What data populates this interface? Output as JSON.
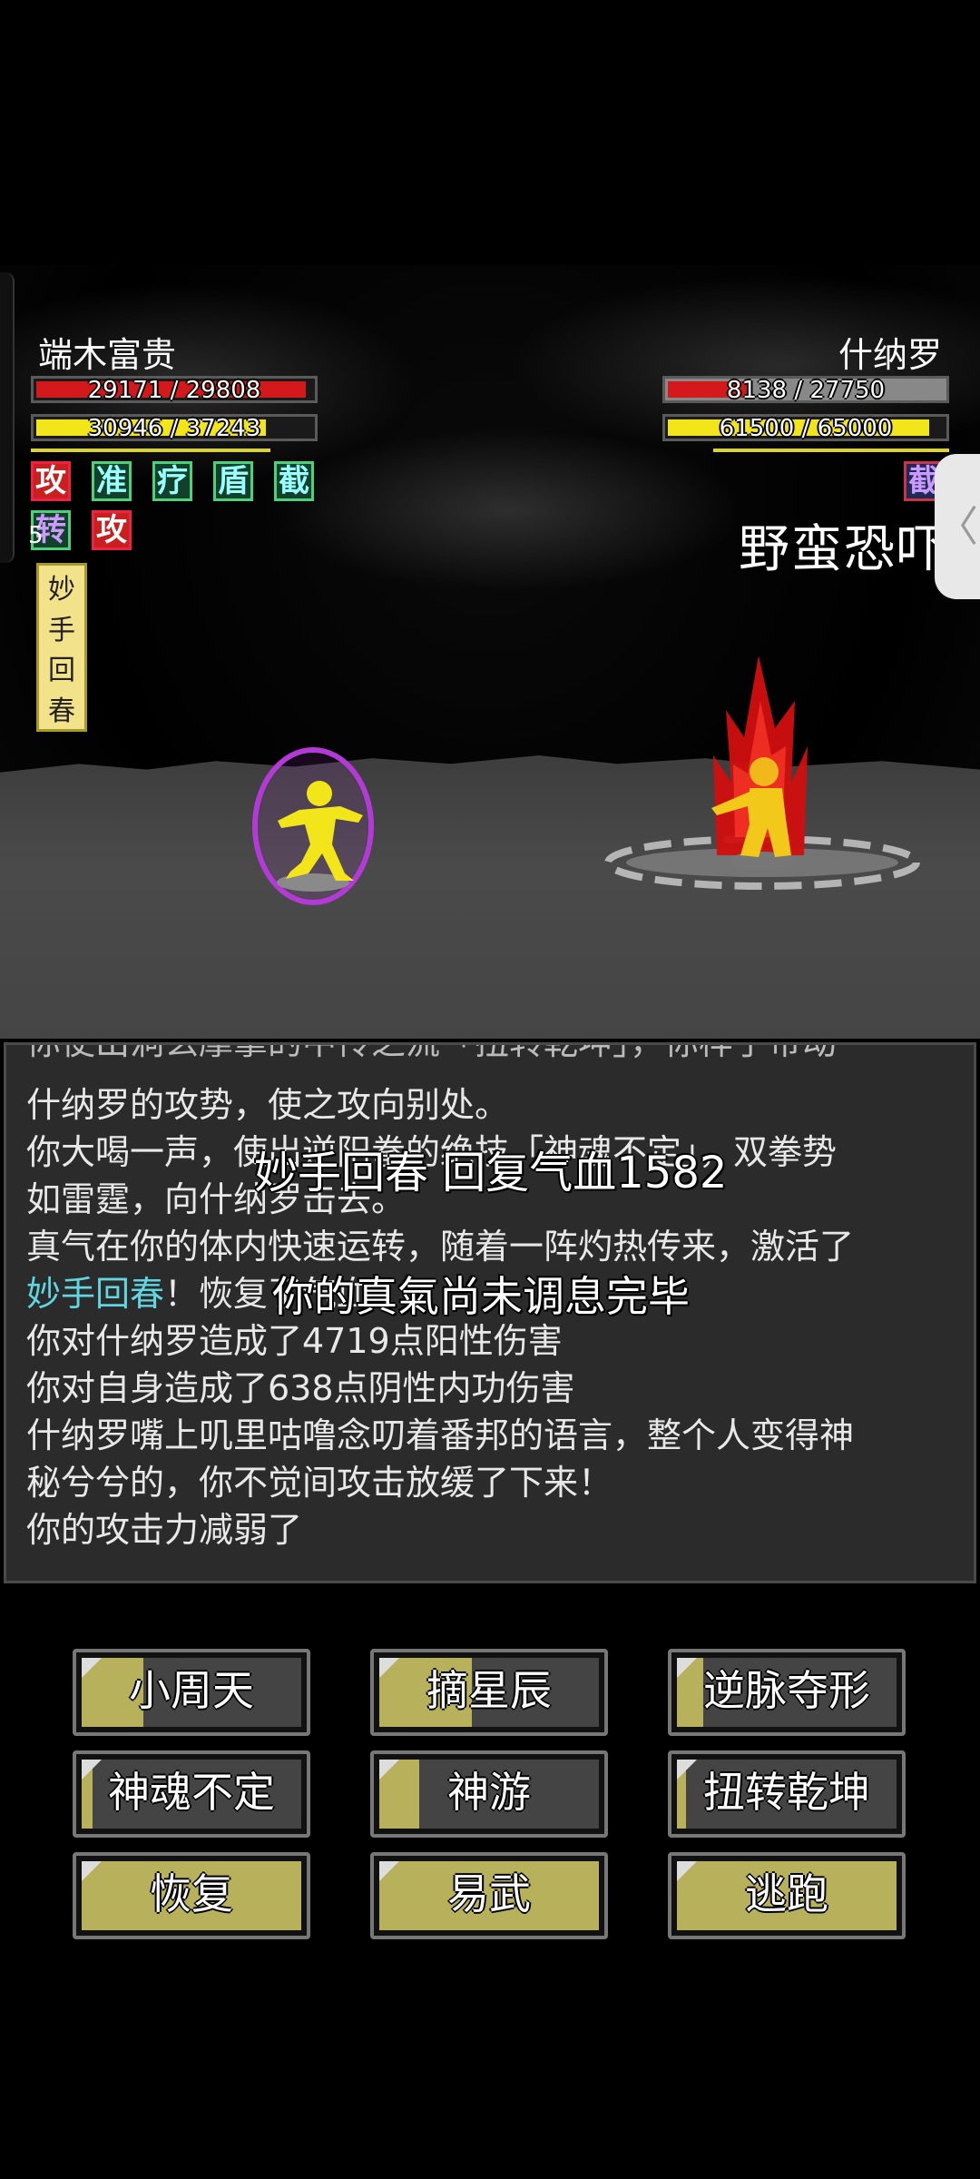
{
  "player": {
    "name": "端木富贵",
    "hp_text": "29171 / 29808",
    "hp_fraction": 0.978,
    "qi_text": "30946 / 37243",
    "qi_fraction": 0.831,
    "buffs": [
      "攻",
      "准",
      "疗",
      "盾",
      "截"
    ],
    "buffs_row2": [
      "转",
      "攻"
    ],
    "buff_count": "5",
    "skill_tag": [
      "妙",
      "手",
      "回",
      "春"
    ]
  },
  "enemy": {
    "name": "什纳罗",
    "hp_text": "8138 / 27750",
    "hp_fraction": 0.293,
    "qi_text": "61500 / 65000",
    "qi_fraction": 0.946,
    "buff": "截",
    "move_name": "野蛮恐吓"
  },
  "floating": {
    "heal": "妙手回春 回复气血1582",
    "notice": "你的真氣尚未调息完毕"
  },
  "log": {
    "cut_line": "你使出洞玄摩掌的中传之流「扭转乾坤」，你样了带动",
    "lines": [
      "什纳罗的攻势，使之攻向别处。",
      "你大喝一声，使出逆阳拳的绝技「神魂不定」，双拳势",
      "如雷霆，向什纳罗击去。",
      "真气在你的体内快速运转，随着一阵灼热传来，激活了",
      "！恢复了气血",
      "你对什纳罗造成了4719点阳性伤害",
      "你对自身造成了638点阴性内功伤害",
      "什纳罗嘴上叽里咕噜念叨着番邦的语言，整个人变得神",
      "秘兮兮的，你不觉间攻击放缓了下来！",
      "你的攻击力减弱了"
    ],
    "highlight": "妙手回春"
  },
  "buttons": [
    {
      "label": "小周天",
      "progress": 0.28
    },
    {
      "label": "摘星辰",
      "progress": 0.42
    },
    {
      "label": "逆脉夺形",
      "progress": 0.12
    },
    {
      "label": "神魂不定",
      "progress": 0.05
    },
    {
      "label": "神游",
      "progress": 0.18
    },
    {
      "label": "扭转乾坤",
      "progress": 0.04
    },
    {
      "label": "恢复",
      "progress": 1.0
    },
    {
      "label": "易武",
      "progress": 1.0
    },
    {
      "label": "逃跑",
      "progress": 1.0
    }
  ],
  "colors": {
    "hp": "#d4191c",
    "qi": "#f2e51a",
    "enemy_hp_empty": "#888888",
    "button_progress": "#b7b15b",
    "highlight_text": "#5fd6e0"
  }
}
